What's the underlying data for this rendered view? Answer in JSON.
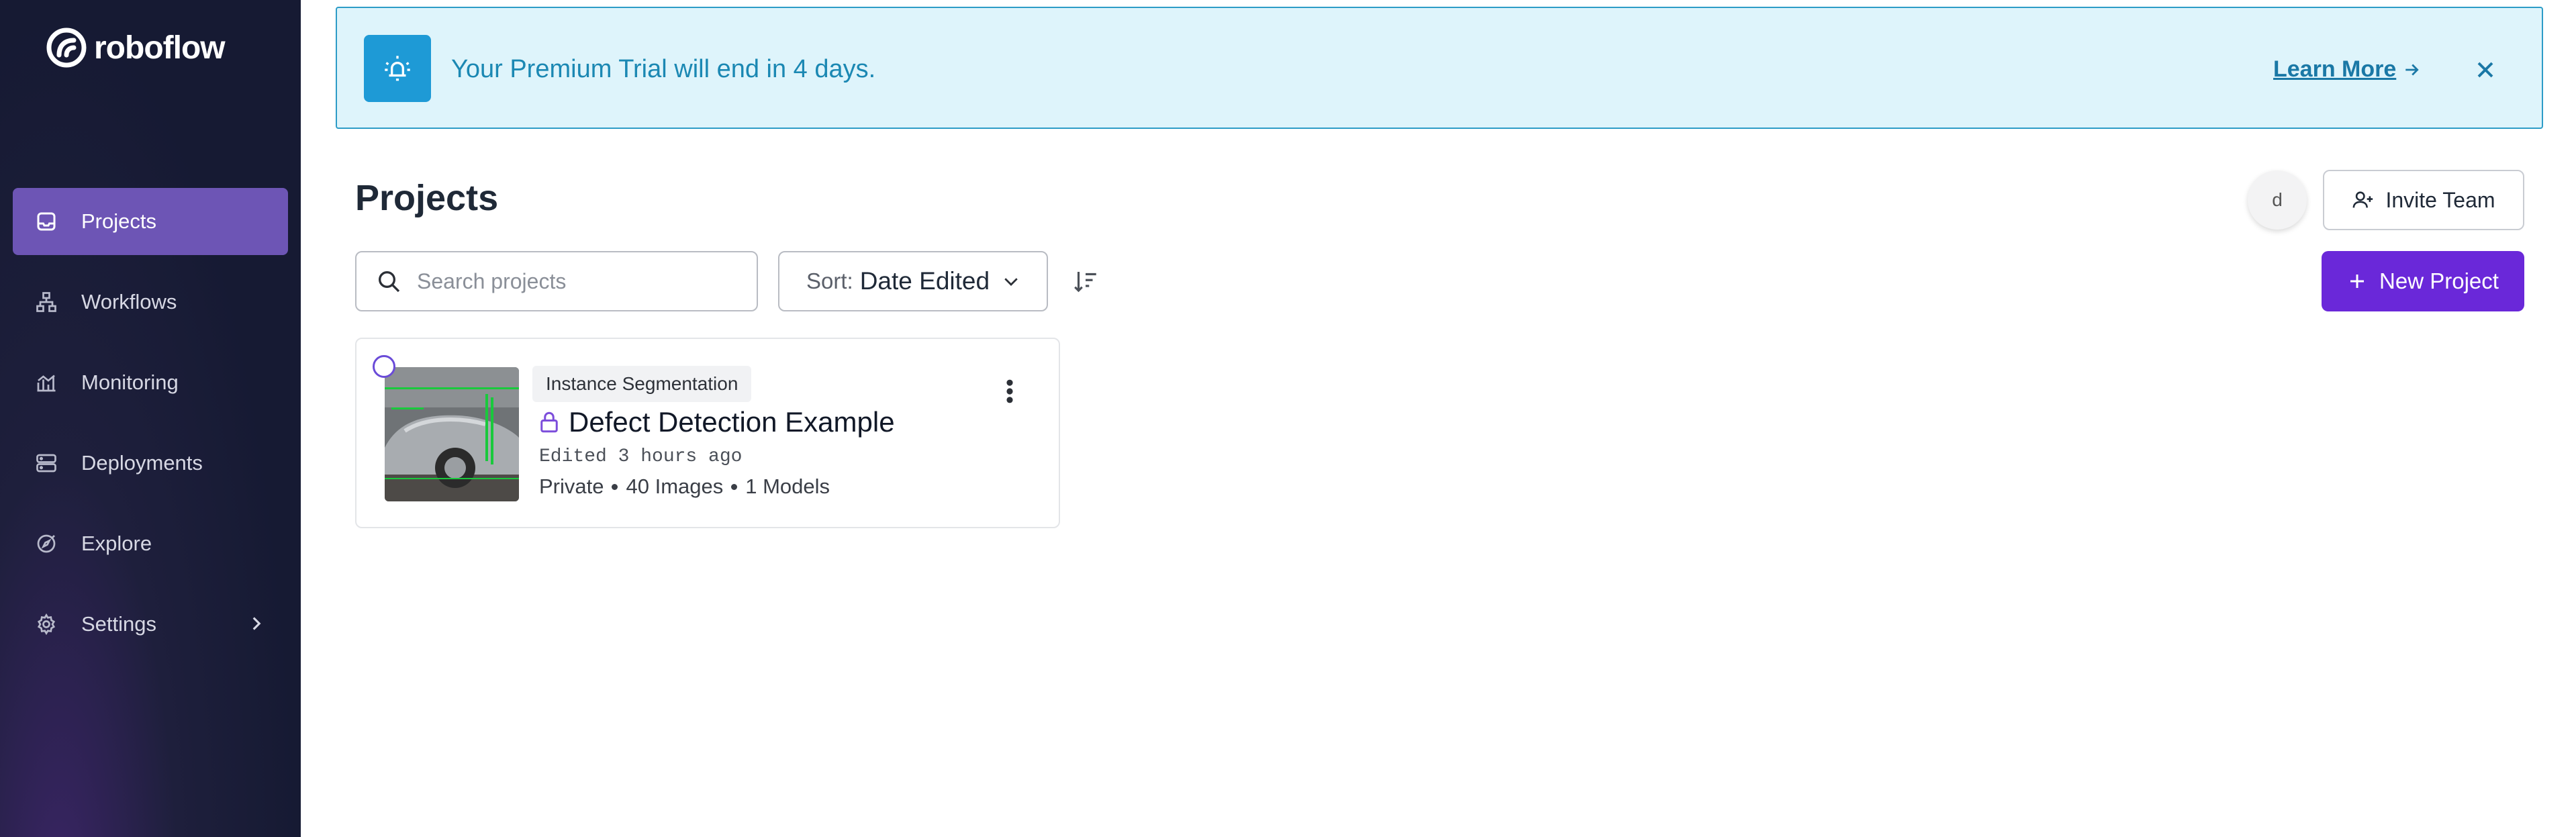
{
  "app": {
    "brand_name": "roboflow"
  },
  "sidebar": {
    "items": [
      {
        "label": "Projects",
        "icon": "inbox-icon",
        "active": true
      },
      {
        "label": "Workflows",
        "icon": "workflow-icon",
        "active": false
      },
      {
        "label": "Monitoring",
        "icon": "chart-icon",
        "active": false
      },
      {
        "label": "Deployments",
        "icon": "server-icon",
        "active": false
      },
      {
        "label": "Explore",
        "icon": "compass-icon",
        "active": false
      },
      {
        "label": "Settings",
        "icon": "gear-icon",
        "active": false,
        "has_submenu": true
      }
    ]
  },
  "banner": {
    "message": "Your Premium Trial will end in 4 days.",
    "link_label": "Learn More",
    "icon": "alarm-bell-icon"
  },
  "main": {
    "title": "Projects",
    "avatar_initial": "d",
    "invite_label": "Invite Team",
    "new_project_label": "New Project",
    "search": {
      "placeholder": "Search projects",
      "value": ""
    },
    "sort": {
      "prefix": "Sort:",
      "value": "Date Edited"
    }
  },
  "projects": [
    {
      "type_tag": "Instance Segmentation",
      "name": "Defect Detection Example",
      "edited": "Edited 3 hours ago",
      "visibility": "Private",
      "images": "40 Images",
      "models": "1 Models",
      "locked": true
    }
  ],
  "colors": {
    "sidebar_bg": "#161a33",
    "active_nav": "#6d55b5",
    "banner_bg": "#def4fb",
    "banner_border": "#2d9cc7",
    "primary": "#6a28d9"
  }
}
